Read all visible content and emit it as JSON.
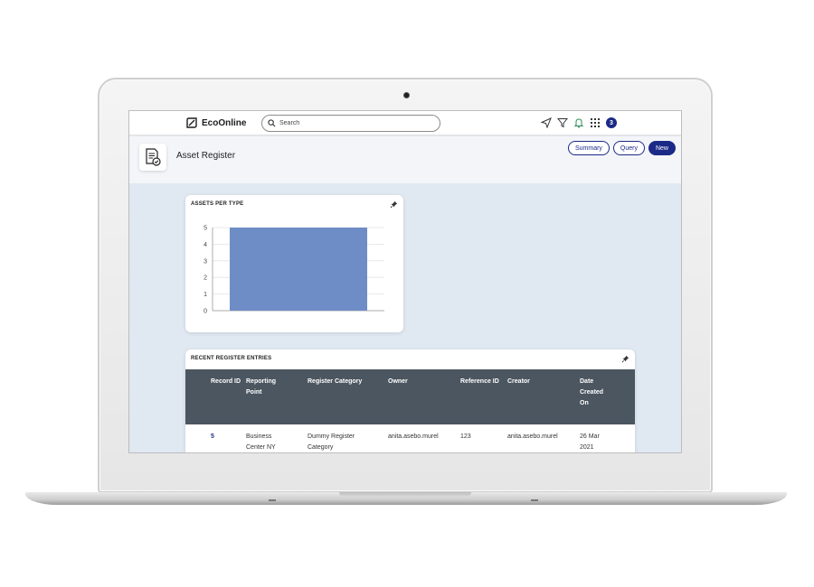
{
  "app": {
    "brand": "EcoOnline"
  },
  "search": {
    "placeholder": "Search"
  },
  "notifications": {
    "count": "3"
  },
  "page": {
    "title": "Asset Register",
    "buttons": {
      "summary": "Summary",
      "query": "Query",
      "new": "New"
    }
  },
  "chart_card": {
    "title": "ASSETS PER TYPE"
  },
  "chart_data": {
    "type": "bar",
    "categories": [
      ""
    ],
    "values": [
      5
    ],
    "ylim": [
      0,
      5
    ],
    "yticks": [
      "0",
      "1",
      "2",
      "3",
      "4",
      "5"
    ],
    "grid": true,
    "color": "#6e8dc7"
  },
  "table_card": {
    "title": "RECENT REGISTER ENTRIES",
    "columns": [
      "Record ID",
      "Reporting Point",
      "Register Category",
      "Owner",
      "Reference ID",
      "Creator",
      "Date Created On"
    ],
    "rows": [
      [
        "5",
        "Business Center NY",
        "Dummy Register Category",
        "anita.asebo.murel",
        "123",
        "anita.asebo.murel",
        "26 Mar 2021"
      ]
    ]
  },
  "colors": {
    "accent": "#1b2a87",
    "table_header": "#4b5660",
    "background": "#e0e8f2"
  }
}
